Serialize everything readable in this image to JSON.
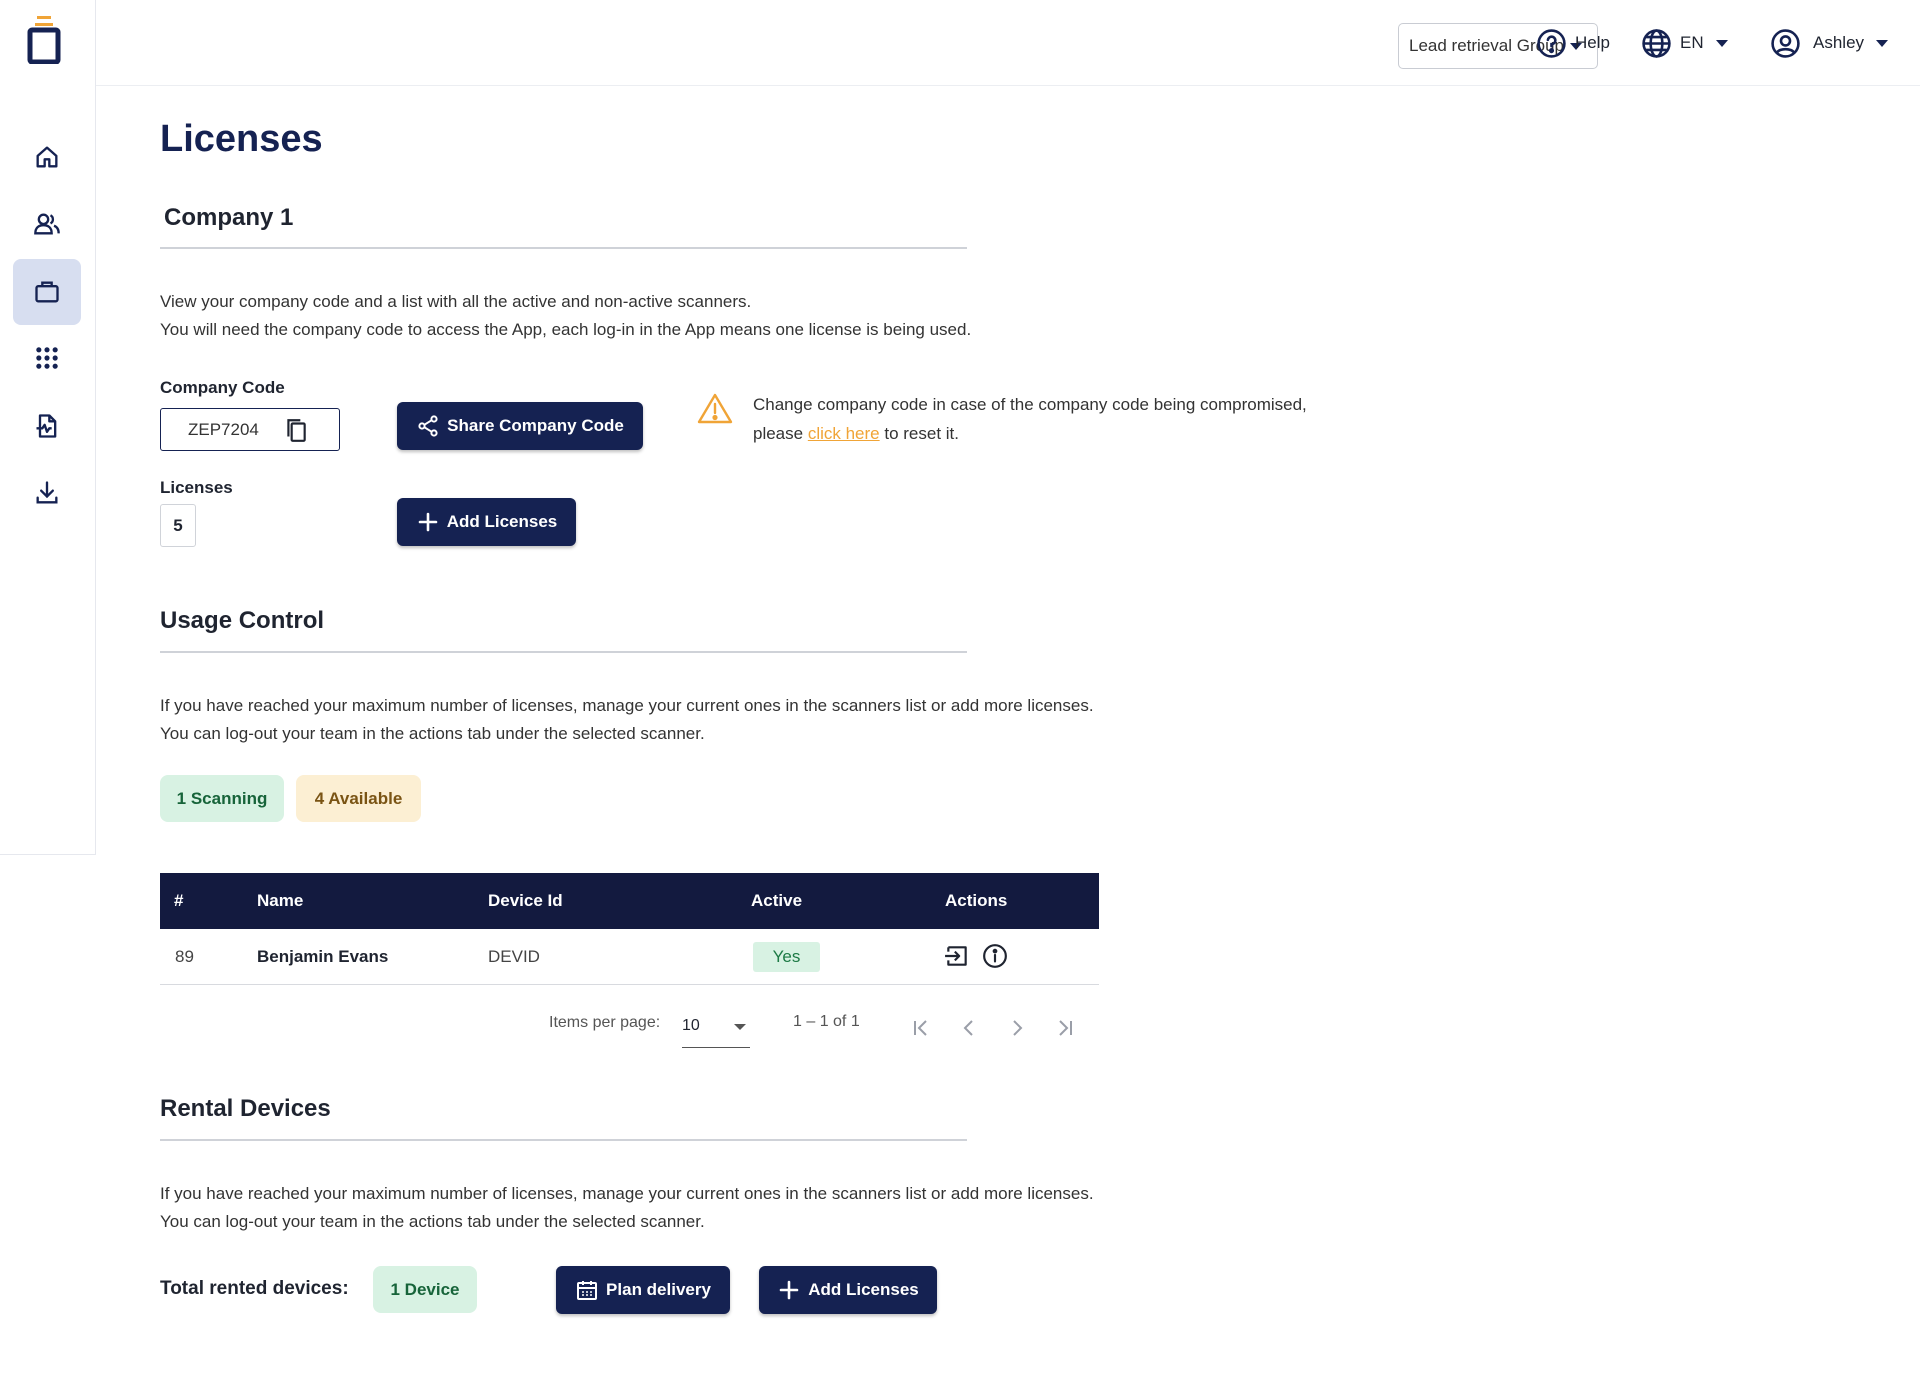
{
  "topbar": {
    "group_select": "Lead retrieval Group",
    "help": "Help",
    "language": "EN",
    "user": "Ashley"
  },
  "sidebar": {
    "items": [
      {
        "name": "home",
        "icon": "home-icon"
      },
      {
        "name": "users",
        "icon": "users-icon"
      },
      {
        "name": "licenses",
        "icon": "briefcase-icon",
        "active": true
      },
      {
        "name": "apps",
        "icon": "grid-icon"
      },
      {
        "name": "reports",
        "icon": "document-chart-icon"
      },
      {
        "name": "downloads",
        "icon": "download-icon"
      }
    ]
  },
  "page": {
    "title": "Licenses"
  },
  "company": {
    "title": "Company 1",
    "description_line1": "View your company code and a list with all the active and non-active scanners.",
    "description_line2": "You will need the company code to access the App, each log-in in the App means one license is being used.",
    "code_label": "Company Code",
    "code_value": "ZEP7204",
    "share_button": "Share Company Code",
    "licenses_label": "Licenses",
    "licenses_value": "5",
    "add_licenses_button": "Add Licenses",
    "warning_line1": "Change company code in case of the company code being compromised,",
    "warning_pre": "please ",
    "warning_link": "click here",
    "warning_post": " to reset it."
  },
  "usage": {
    "title": "Usage Control",
    "description_line1": "If you have reached your maximum number of licenses, manage your current ones in the scanners list or add more licenses.",
    "description_line2": "You can log-out your team in the actions tab under the selected scanner.",
    "scanning_badge": "1 Scanning",
    "available_badge": "4 Available"
  },
  "table": {
    "headers": {
      "num": "#",
      "name": "Name",
      "device": "Device Id",
      "active": "Active",
      "actions": "Actions"
    },
    "rows": [
      {
        "num": "89",
        "name": "Benjamin Evans",
        "device": "DEVID",
        "active": "Yes"
      }
    ]
  },
  "pager": {
    "items_per_page_label": "Items per page:",
    "items_per_page_value": "10",
    "range": "1 – 1 of 1"
  },
  "rental": {
    "title": "Rental Devices",
    "description_line1": "If you have reached your maximum number of licenses, manage your current ones in the scanners list or add more licenses.",
    "description_line2": "You can log-out your team in the actions tab under the selected scanner.",
    "total_label": "Total rented devices:",
    "device_badge": "1 Device",
    "plan_button": "Plan delivery",
    "add_licenses_button": "Add Licenses"
  },
  "colors": {
    "primary": "#152252",
    "table_header": "#131a3f",
    "accent_orange": "#f0a437",
    "success_bg": "#d8f2e3",
    "warning_bg": "#fcefd3"
  }
}
